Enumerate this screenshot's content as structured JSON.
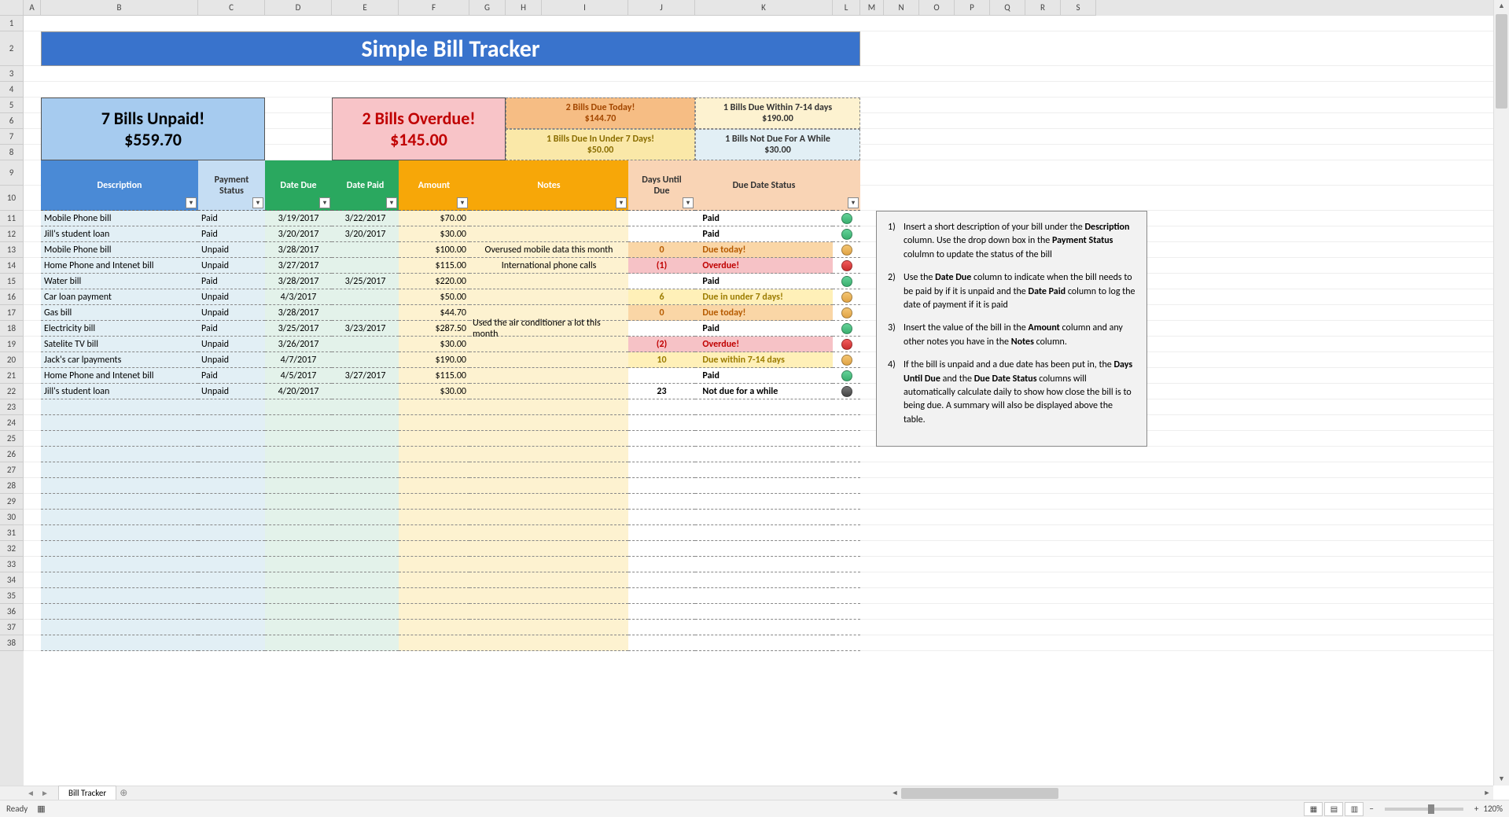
{
  "cols": [
    "A",
    "B",
    "C",
    "D",
    "E",
    "F",
    "G",
    "H",
    "I",
    "J",
    "K",
    "L",
    "M",
    "N",
    "O",
    "P",
    "Q",
    "R",
    "S"
  ],
  "rows": [
    1,
    2,
    3,
    4,
    5,
    6,
    7,
    8,
    9,
    10,
    11,
    12,
    13,
    14,
    15,
    16,
    17,
    18,
    19,
    20,
    21,
    22,
    23,
    24,
    25,
    26,
    27,
    28,
    29,
    30,
    31,
    32,
    33,
    34,
    35,
    36,
    37,
    38
  ],
  "title": "Simple Bill Tracker",
  "summary": {
    "unpaid": {
      "label": "7 Bills Unpaid!",
      "amount": "$559.70"
    },
    "overdue": {
      "label": "2 Bills Overdue!",
      "amount": "$145.00"
    },
    "dueToday": {
      "label": "2 Bills Due Today!",
      "amount": "$144.70"
    },
    "dueUnder7": {
      "label": "1 Bills Due In Under 7 Days!",
      "amount": "$50.00"
    },
    "due7_14": {
      "label": "1 Bills Due Within 7-14 days",
      "amount": "$190.00"
    },
    "notDue": {
      "label": "1 Bills Not Due For A While",
      "amount": "$30.00"
    }
  },
  "headers": {
    "description": "Description",
    "paymentStatus": "Payment Status",
    "dateDue": "Date Due",
    "datePaid": "Date Paid",
    "amount": "Amount",
    "notes": "Notes",
    "daysUntilDue": "Days Until Due",
    "dueDateStatus": "Due Date Status"
  },
  "data": [
    {
      "desc": "Mobile Phone bill",
      "status": "Paid",
      "due": "3/19/2017",
      "paid": "3/22/2017",
      "amount": "$70.00",
      "notes": "",
      "days": "",
      "dstatus": "Paid",
      "dot": "green",
      "rowbg": ""
    },
    {
      "desc": "Jill's student loan",
      "status": "Paid",
      "due": "3/20/2017",
      "paid": "3/20/2017",
      "amount": "$30.00",
      "notes": "",
      "days": "",
      "dstatus": "Paid",
      "dot": "green",
      "rowbg": ""
    },
    {
      "desc": "Mobile Phone bill",
      "status": "Unpaid",
      "due": "3/28/2017",
      "paid": "",
      "amount": "$100.00",
      "notes": "Overused mobile data this month",
      "days": "0",
      "dstatus": "Due today!",
      "dot": "orange",
      "rowbg": "peach",
      "tc": "orange"
    },
    {
      "desc": "Home Phone and Intenet bill",
      "status": "Unpaid",
      "due": "3/27/2017",
      "paid": "",
      "amount": "$115.00",
      "notes": "International phone calls",
      "days": "(1)",
      "dstatus": "Overdue!",
      "dot": "red",
      "rowbg": "pink",
      "tc": "red"
    },
    {
      "desc": "Water bill",
      "status": "Paid",
      "due": "3/28/2017",
      "paid": "3/25/2017",
      "amount": "$220.00",
      "notes": "",
      "days": "",
      "dstatus": "Paid",
      "dot": "green",
      "rowbg": ""
    },
    {
      "desc": "Car loan payment",
      "status": "Unpaid",
      "due": "4/3/2017",
      "paid": "",
      "amount": "$50.00",
      "notes": "",
      "days": "6",
      "dstatus": "Due in under 7 days!",
      "dot": "orange",
      "rowbg": "yellow",
      "tc": "yellow"
    },
    {
      "desc": "Gas bill",
      "status": "Unpaid",
      "due": "3/28/2017",
      "paid": "",
      "amount": "$44.70",
      "notes": "",
      "days": "0",
      "dstatus": "Due today!",
      "dot": "orange",
      "rowbg": "peach",
      "tc": "orange"
    },
    {
      "desc": "Electricity bill",
      "status": "Paid",
      "due": "3/25/2017",
      "paid": "3/23/2017",
      "amount": "$287.50",
      "notes": "Used the air conditioner a lot this month",
      "days": "",
      "dstatus": "Paid",
      "dot": "green",
      "rowbg": ""
    },
    {
      "desc": "Satelite TV bill",
      "status": "Unpaid",
      "due": "3/26/2017",
      "paid": "",
      "amount": "$30.00",
      "notes": "",
      "days": "(2)",
      "dstatus": "Overdue!",
      "dot": "red",
      "rowbg": "pink",
      "tc": "red"
    },
    {
      "desc": "Jack's car lpayments",
      "status": "Unpaid",
      "due": "4/7/2017",
      "paid": "",
      "amount": "$190.00",
      "notes": "",
      "days": "10",
      "dstatus": "Due within 7-14 days",
      "dot": "orange",
      "rowbg": "yellow",
      "tc": "yellow"
    },
    {
      "desc": "Home Phone and Intenet bill",
      "status": "Paid",
      "due": "4/5/2017",
      "paid": "3/27/2017",
      "amount": "$115.00",
      "notes": "",
      "days": "",
      "dstatus": "Paid",
      "dot": "green",
      "rowbg": ""
    },
    {
      "desc": "Jill's student loan",
      "status": "Unpaid",
      "due": "4/20/2017",
      "paid": "",
      "amount": "$30.00",
      "notes": "",
      "days": "23",
      "dstatus": "Not due for a while",
      "dot": "gray",
      "rowbg": ""
    }
  ],
  "instructions": [
    {
      "n": "1)",
      "text": "Insert a short description of your bill under the <b>Description</b> column. Use the drop down box in the <b>Payment Status</b> colulmn to update the status of the bill"
    },
    {
      "n": "2)",
      "text": "Use the <b>Date Due</b> column to indicate when the bill needs to be paid by if it is unpaid and the <b>Date Paid</b> column to log the date of payment if it is paid"
    },
    {
      "n": "3)",
      "text": "Insert the value of the bill in the <b>Amount</b> column and any other notes you have in the <b>Notes</b> column."
    },
    {
      "n": "4)",
      "text": "If the bill is unpaid and a due date has been put in, the <b>Days Until Due</b> and the <b>Due Date Status</b> columns will automatically calculate daily to show how close the bill is to being due. A summary will also be displayed above the table."
    }
  ],
  "sheetTab": "Bill Tracker",
  "statusReady": "Ready",
  "zoom": "120%"
}
